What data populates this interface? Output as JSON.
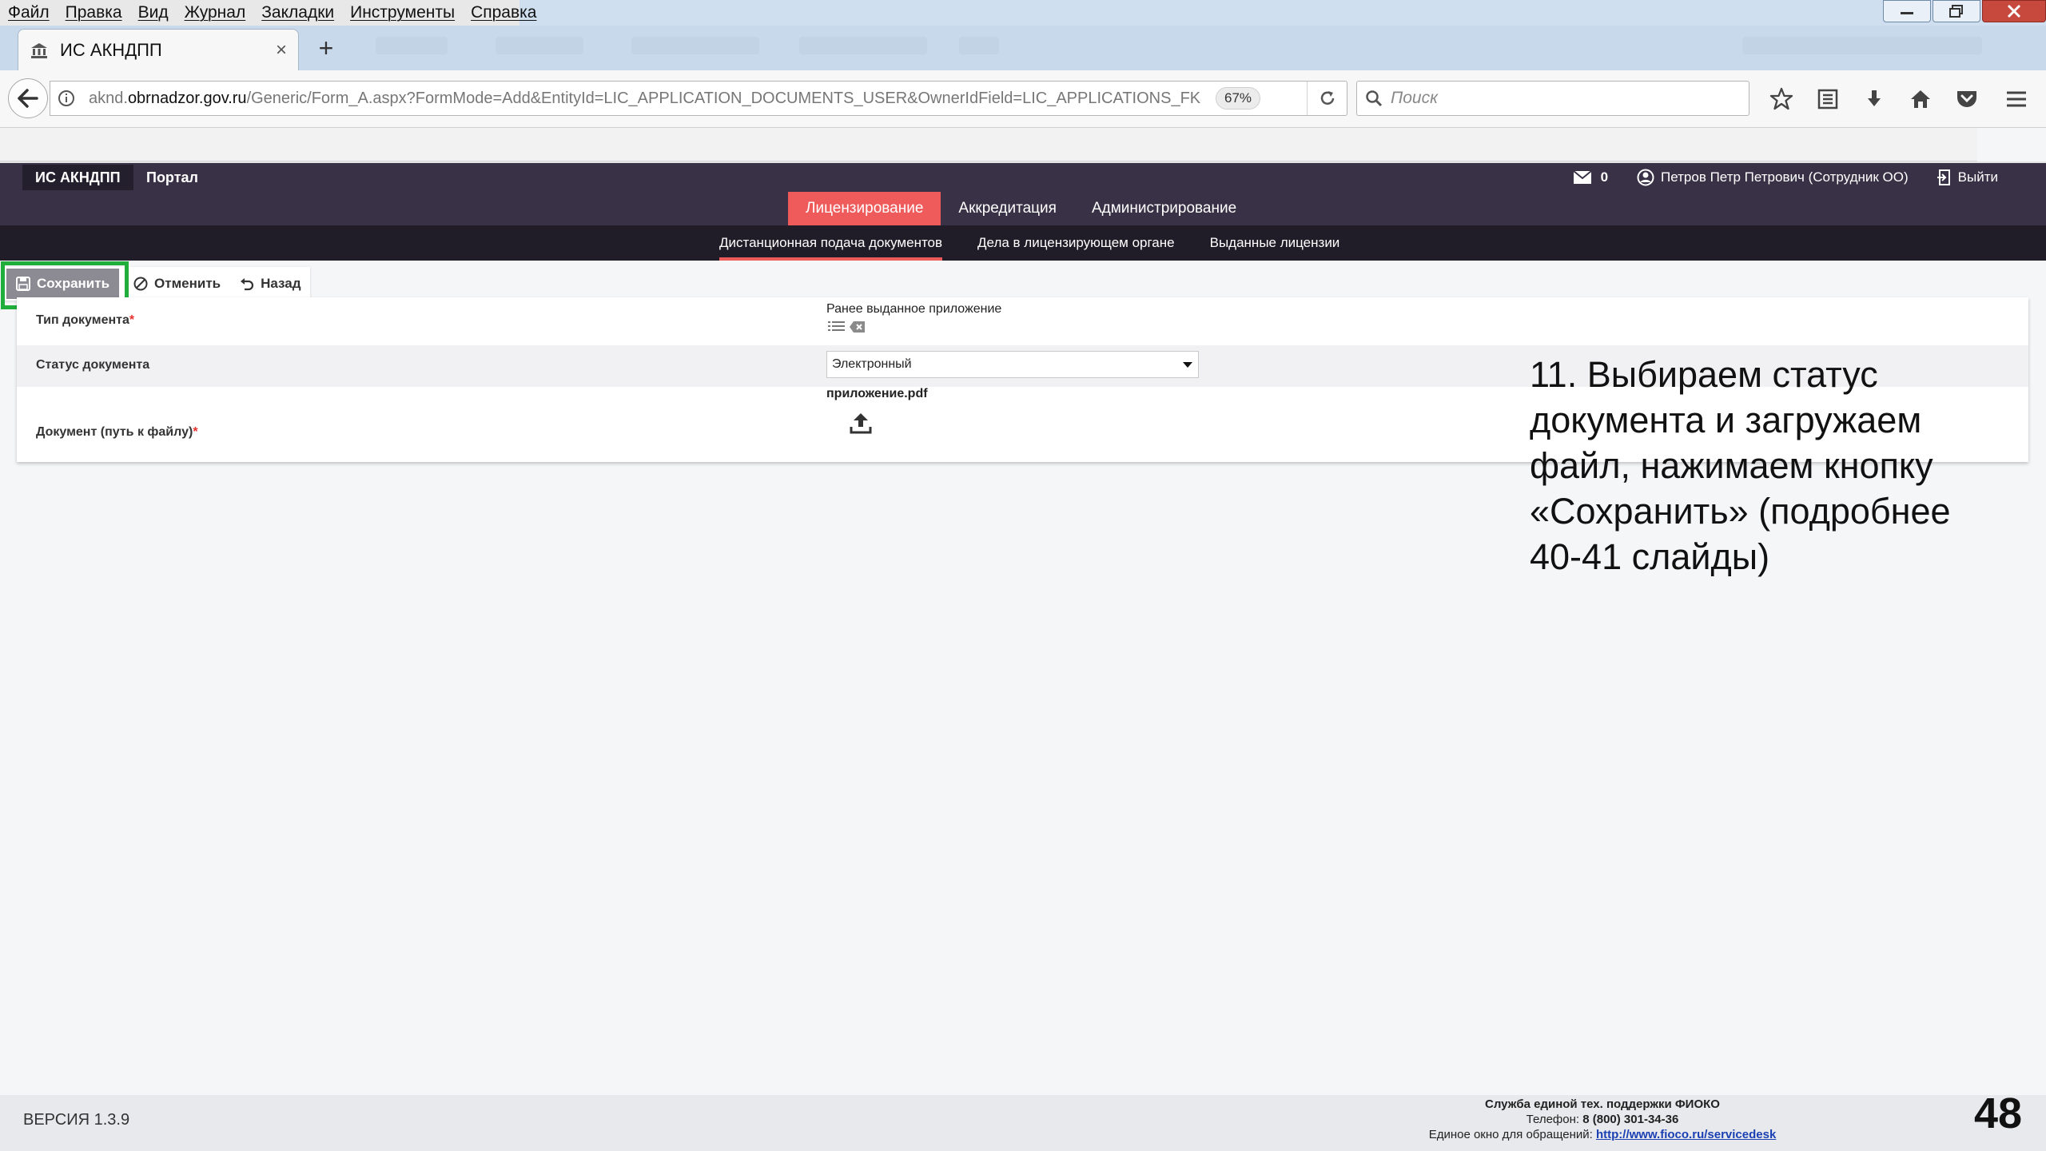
{
  "browser": {
    "menu": [
      "Файл",
      "Правка",
      "Вид",
      "Журнал",
      "Закладки",
      "Инструменты",
      "Справка"
    ],
    "tab_title": "ИС АКНДПП",
    "url_domain": "akndobrnadzor.gov.ru",
    "url_prefix": "aknd.",
    "url_domain_main": "obrnadzor.gov.ru",
    "url_path": "/Generic/Form_A.aspx?FormMode=Add&EntityId=LIC_APPLICATION_DOCUMENTS_USER&OwnerIdField=LIC_APPLICATIONS_FK&OwnerIc",
    "zoom": "67%",
    "search_placeholder": "Поиск"
  },
  "app": {
    "brand": "ИС АКНДПП",
    "portal": "Портал",
    "message_count": "0",
    "user": "Петров Петр Петрович (Сотрудник ОО)",
    "logout": "Выйти",
    "main_nav": [
      "Лицензирование",
      "Аккредитация",
      "Администрирование"
    ],
    "sub_nav": [
      "Дистанционная подача документов",
      "Дела в лицензирующем органе",
      "Выданные лицензии"
    ]
  },
  "actions": {
    "save": "Сохранить",
    "cancel": "Отменить",
    "back": "Назад"
  },
  "form": {
    "doc_type_label": "Тип документа",
    "doc_type_value": "Ранее выданное приложение",
    "doc_status_label": "Статус документа",
    "doc_status_value": "Электронный",
    "doc_file_label": "Документ (путь к файлу)",
    "doc_file_name": "приложение.pdf",
    "required_mark": "*"
  },
  "annotation": "11. Выбираем статус документа и загружаем файл, нажимаем кнопку «Сохранить» (подробнее 40-41 слайды)",
  "footer": {
    "version": "ВЕРСИЯ 1.3.9",
    "support_title": "Служба единой тех. поддержки ФИОКО",
    "support_phone_label": "Телефон:",
    "support_phone": "8 (800) 301-34-36",
    "support_window_label": "Единое окно для обращений:",
    "support_link": "http://www.fioco.ru/servicedesk"
  },
  "slide_number": "48",
  "colors": {
    "header_bg": "#393246",
    "subnav_bg": "#211d28",
    "accent": "#ef5b5b",
    "highlight": "#1fae3b"
  }
}
